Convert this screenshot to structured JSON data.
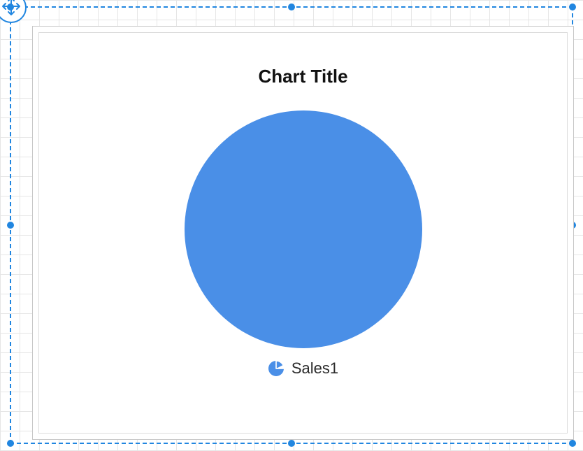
{
  "chart_data": {
    "type": "pie",
    "title": "Chart Title",
    "series": [
      {
        "name": "Sales1",
        "values": [
          1
        ]
      }
    ],
    "colors": {
      "Sales1": "#4a8fe7"
    },
    "legend_position": "bottom"
  },
  "ui": {
    "accent": "#2186e0"
  }
}
